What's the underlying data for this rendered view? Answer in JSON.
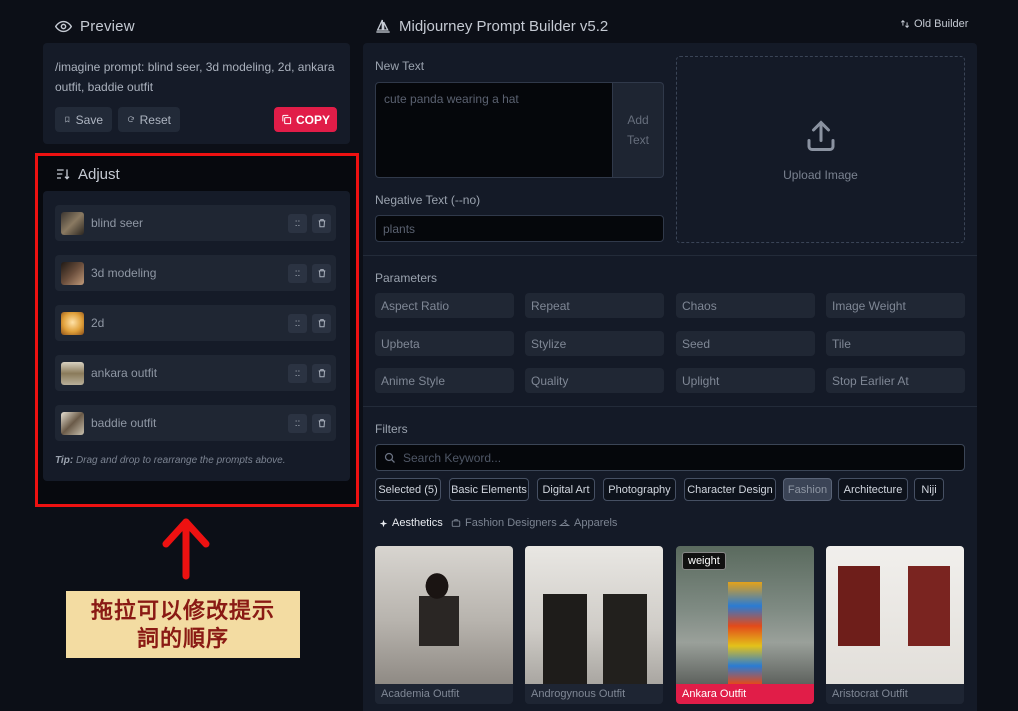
{
  "preview": {
    "title": "Preview",
    "prompt": "/imagine prompt: blind seer, 3d modeling, 2d, ankara outfit, baddie outfit",
    "save_label": "Save",
    "reset_label": "Reset",
    "copy_label": "COPY"
  },
  "adjust": {
    "title": "Adjust",
    "items": [
      {
        "label": "blind seer",
        "thumb_color": "#8a7a62"
      },
      {
        "label": "3d modeling",
        "thumb_color": "#6a4e3c"
      },
      {
        "label": "2d",
        "thumb_color": "#e0a03a"
      },
      {
        "label": "ankara outfit",
        "thumb_color": "#b9b09a"
      },
      {
        "label": "baddie outfit",
        "thumb_color": "#c8c0ae"
      }
    ],
    "drag_icon_text": "::",
    "tip_label": "Tip:",
    "tip_text": "Drag and drop to rearrange the prompts above."
  },
  "annotation": {
    "line1": "拖拉可以修改提示",
    "line2": "詞的順序",
    "arrow_color": "#ee1111"
  },
  "header": {
    "title": "Midjourney Prompt Builder v5.2",
    "old_builder_label": "Old Builder"
  },
  "new_text": {
    "label": "New Text",
    "placeholder": "cute panda wearing a hat",
    "add_label_1": "Add",
    "add_label_2": "Text"
  },
  "upload": {
    "label": "Upload Image"
  },
  "negative": {
    "label": "Negative Text (--no)",
    "placeholder": "plants"
  },
  "parameters": {
    "label": "Parameters",
    "items": [
      "Aspect Ratio",
      "Repeat",
      "Chaos",
      "Image Weight",
      "Upbeta",
      "Stylize",
      "Seed",
      "Tile",
      "Anime Style",
      "Quality",
      "Uplight",
      "Stop Earlier At"
    ]
  },
  "filters": {
    "label": "Filters",
    "search_placeholder": "Search Keyword...",
    "tabs": [
      "Selected (5)",
      "Basic Elements",
      "Digital Art",
      "Photography",
      "Character Design",
      "Fashion",
      "Architecture",
      "Niji"
    ],
    "active_tab": "Fashion",
    "subtabs": [
      "Aesthetics",
      "Fashion Designers",
      "Apparels"
    ],
    "active_subtab": "Aesthetics"
  },
  "cards": [
    {
      "caption": "Academia Outfit",
      "badge": ""
    },
    {
      "caption": "Androgynous Outfit",
      "badge": ""
    },
    {
      "caption": "Ankara Outfit",
      "badge": "weight"
    },
    {
      "caption": "Aristocrat Outfit",
      "badge": ""
    }
  ],
  "colors": {
    "accent": "#e11d48",
    "panel": "#141a27",
    "background": "#0c0f17"
  }
}
